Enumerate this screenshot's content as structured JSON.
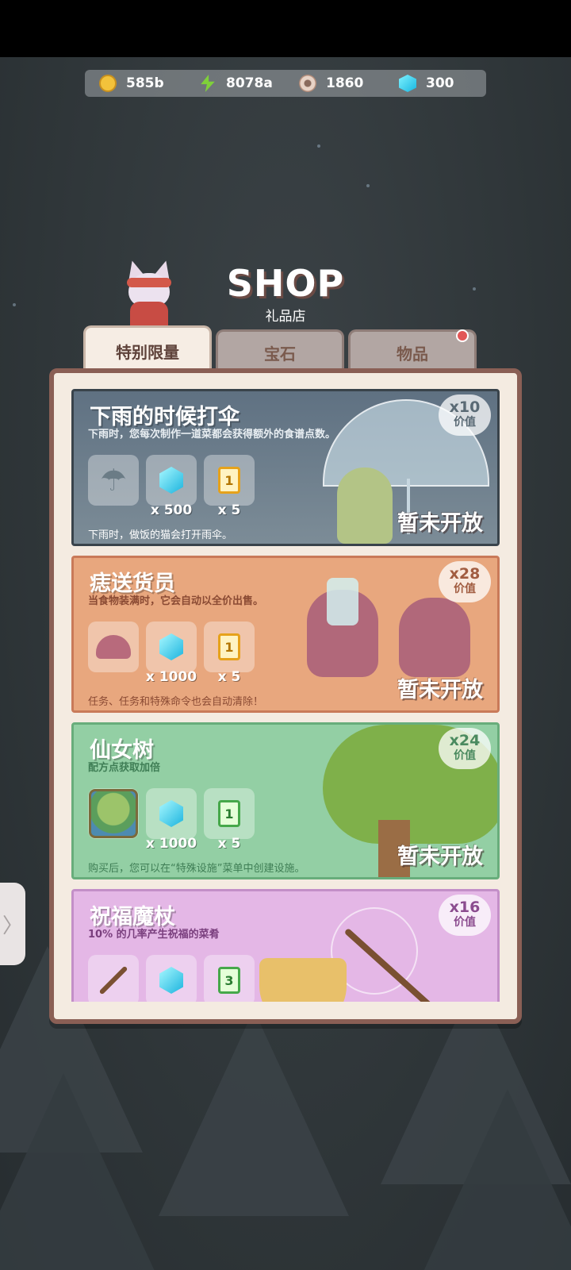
{
  "resources": [
    {
      "icon": "coin-icon",
      "value": "585b"
    },
    {
      "icon": "energy-bolt-icon",
      "value": "8078a"
    },
    {
      "icon": "donut-icon",
      "value": "1860"
    },
    {
      "icon": "gem-icon",
      "value": "300"
    }
  ],
  "header": {
    "title": "SHOP",
    "subtitle": "礼品店"
  },
  "tabs": [
    {
      "label": "特别限量",
      "active": true
    },
    {
      "label": "宝石",
      "active": false
    },
    {
      "label": "物品",
      "active": false,
      "badge": true
    }
  ],
  "cards": [
    {
      "name": "下雨的时候打伞",
      "description": "下雨时，您每次制作一道菜都会获得额外的食谱点数。",
      "note": "下雨时，做饭的猫会打开雨伞。",
      "value_multiplier": "x10",
      "value_label": "价值",
      "status": "暂未开放",
      "items": [
        {
          "icon": "umbrella-icon",
          "qty": ""
        },
        {
          "icon": "gem-icon",
          "qty": "x 500"
        },
        {
          "icon": "ticket-icon",
          "ticket_num": "1",
          "qty": "x 5"
        }
      ]
    },
    {
      "name": "痣送货员",
      "description": "当食物装满时，它会自动以全价出售。",
      "note": "任务、任务和特殊命令也会自动清除！",
      "value_multiplier": "x28",
      "value_label": "价值",
      "status": "暂未开放",
      "items": [
        {
          "icon": "mole-icon",
          "qty": ""
        },
        {
          "icon": "gem-icon",
          "qty": "x 1000"
        },
        {
          "icon": "ticket-icon",
          "ticket_num": "1",
          "qty": "x 5"
        }
      ]
    },
    {
      "name": "仙女树",
      "description": "配方点获取加倍",
      "note": "购买后，您可以在“特殊设施”菜单中创建设施。",
      "value_multiplier": "x24",
      "value_label": "价值",
      "status": "暂未开放",
      "items": [
        {
          "icon": "fairy-tree-icon",
          "qty": ""
        },
        {
          "icon": "gem-icon",
          "qty": "x 1000"
        },
        {
          "icon": "green-ticket-icon",
          "ticket_num": "1",
          "qty": "x 5"
        }
      ]
    },
    {
      "name": "祝福魔杖",
      "description": "10% 的几率产生祝福的菜肴",
      "value_multiplier": "x16",
      "value_label": "价值",
      "items": [
        {
          "icon": "magic-wand-icon",
          "qty": ""
        },
        {
          "icon": "gem-icon",
          "qty": ""
        },
        {
          "icon": "green-ticket-icon",
          "ticket_num": "3",
          "qty": ""
        }
      ]
    }
  ],
  "side_tab": {
    "glyph": "〉"
  }
}
